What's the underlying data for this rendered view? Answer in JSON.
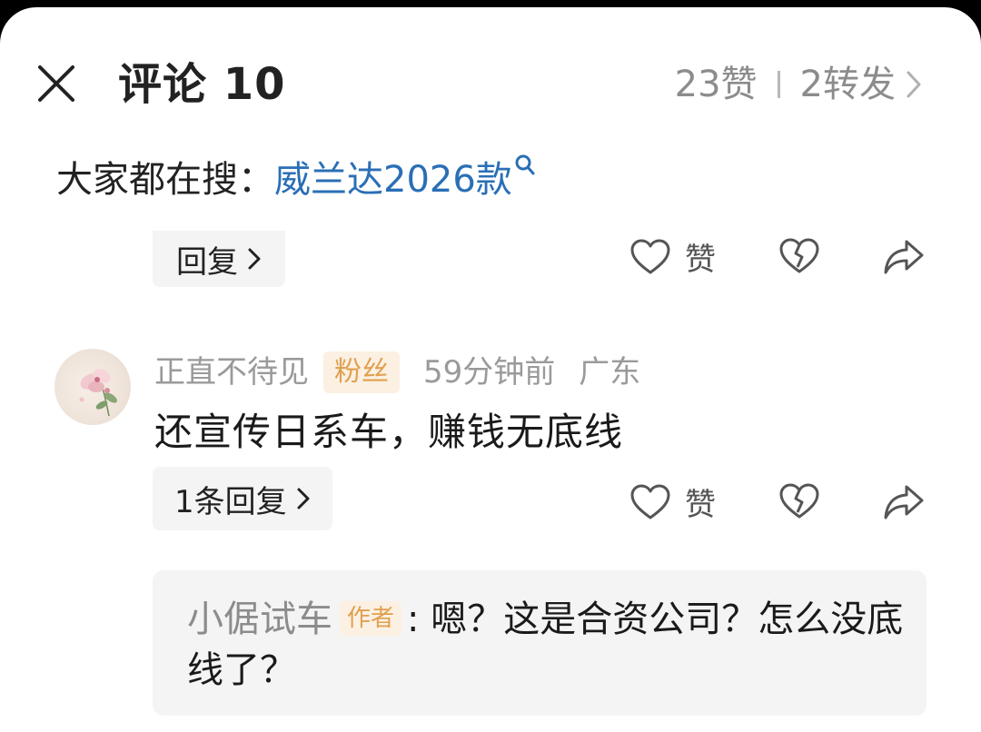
{
  "header": {
    "title": "评论 10",
    "likes": "23赞",
    "reposts": "2转发"
  },
  "search": {
    "prefix": "大家都在搜：",
    "keyword": "威兰达2026款"
  },
  "previous_comment": {
    "reply_label": "回复",
    "like_label": "赞"
  },
  "comment": {
    "user_name": "正直不待见",
    "badge": "粉丝",
    "time": "59分钟前",
    "location": "广东",
    "text": "还宣传日系车，赚钱无底线",
    "reply_label": "1条回复",
    "like_label": "赞",
    "sub_reply": {
      "author": "小倨试车",
      "author_badge": "作者",
      "text": ": 嗯？这是合资公司？怎么没底线了？"
    }
  },
  "colors": {
    "link_blue": "#2a6fb5",
    "badge_orange": "#e0a050",
    "muted_gray": "#8c8c8c"
  },
  "icons": [
    "close-icon",
    "chevron-right-icon",
    "search-icon",
    "heart-icon",
    "broken-heart-icon",
    "share-icon"
  ]
}
